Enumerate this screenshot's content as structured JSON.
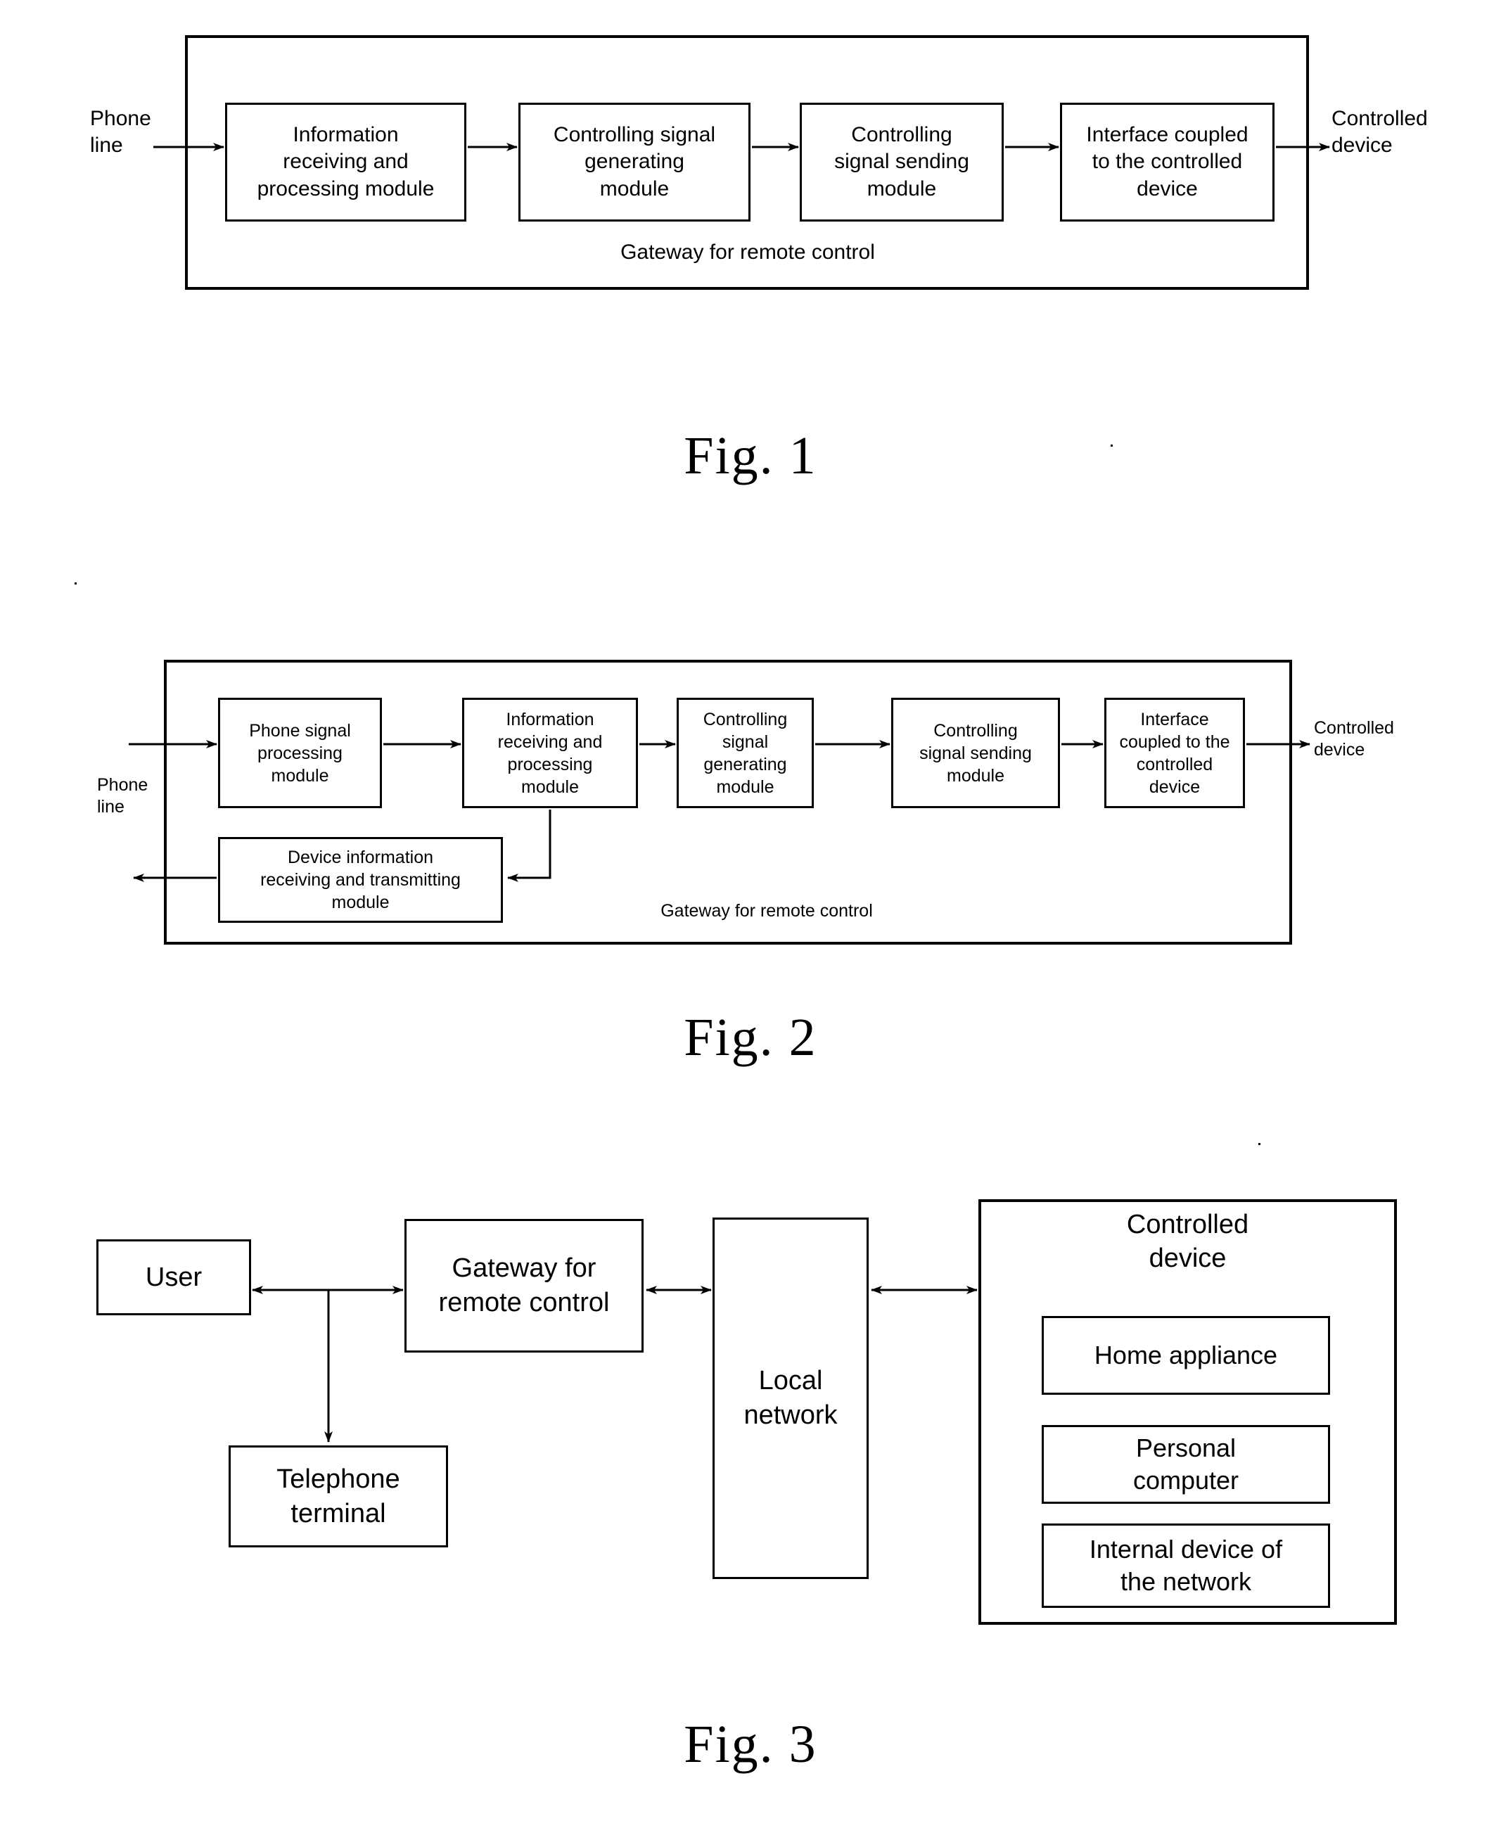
{
  "document": {
    "type": "patent-figure-sheet",
    "figures": [
      {
        "id": "fig1",
        "caption": "Fig. 1",
        "container_label": "Gateway for remote control",
        "external_labels": {
          "input": "Phone\nline",
          "output": "Controlled\ndevice"
        },
        "blocks": [
          {
            "id": "f1b1",
            "label": "Information\nreceiving and\nprocessing module"
          },
          {
            "id": "f1b2",
            "label": "Controlling signal\ngenerating\nmodule"
          },
          {
            "id": "f1b3",
            "label": "Controlling\nsignal sending\nmodule"
          },
          {
            "id": "f1b4",
            "label": "Interface coupled\nto the controlled\ndevice"
          }
        ]
      },
      {
        "id": "fig2",
        "caption": "Fig. 2",
        "container_label": "Gateway for remote control",
        "external_labels": {
          "input": "Phone\nline",
          "output": "Controlled\ndevice"
        },
        "blocks": [
          {
            "id": "f2b1",
            "label": "Phone signal\nprocessing\nmodule"
          },
          {
            "id": "f2b2",
            "label": "Information\nreceiving and\nprocessing\nmodule"
          },
          {
            "id": "f2b3",
            "label": "Controlling\nsignal\ngenerating\nmodule"
          },
          {
            "id": "f2b4",
            "label": "Controlling\nsignal sending\nmodule"
          },
          {
            "id": "f2b5",
            "label": "Interface\ncoupled to the\ncontrolled\ndevice"
          },
          {
            "id": "f2b6",
            "label": "Device information\nreceiving and transmitting\nmodule"
          }
        ]
      },
      {
        "id": "fig3",
        "caption": "Fig. 3",
        "blocks": [
          {
            "id": "f3user",
            "label": "User"
          },
          {
            "id": "f3gateway",
            "label": "Gateway for\nremote control"
          },
          {
            "id": "f3telephone",
            "label": "Telephone\nterminal"
          },
          {
            "id": "f3network",
            "label": "Local\nnetwork"
          },
          {
            "id": "f3controlled",
            "label": "Controlled\ndevice"
          },
          {
            "id": "f3appliance",
            "label": "Home appliance"
          },
          {
            "id": "f3pc",
            "label": "Personal\ncomputer"
          },
          {
            "id": "f3internal",
            "label": "Internal device of\nthe network"
          }
        ]
      }
    ]
  },
  "colors": {
    "ink": "#000000",
    "paper": "#ffffff"
  }
}
